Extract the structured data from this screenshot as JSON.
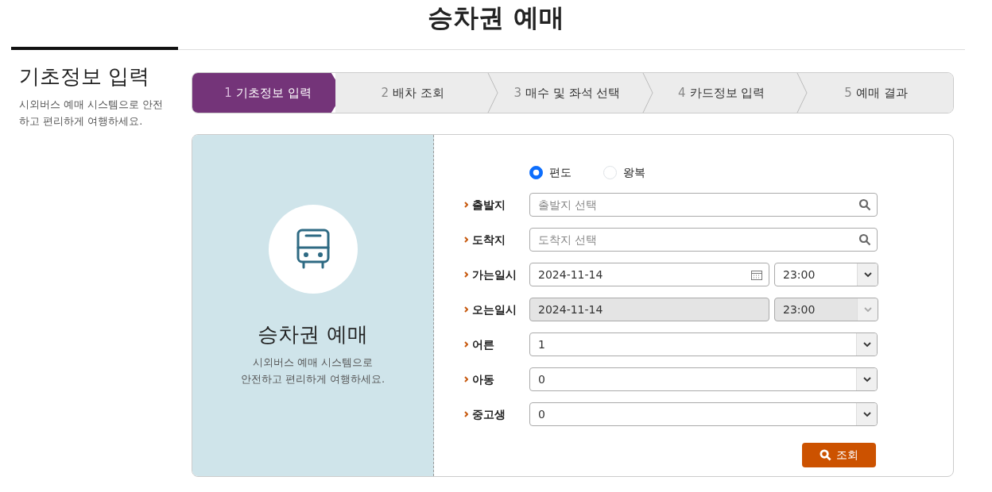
{
  "page_title": "승차권 예매",
  "sidebar": {
    "heading": "기초정보 입력",
    "description": "시외버스 예매 시스템으로 안전하고 편리하게 여행하세요."
  },
  "steps": [
    {
      "number": "1",
      "label": "기초정보 입력",
      "selected": true
    },
    {
      "number": "2",
      "label": "배차 조회",
      "selected": false
    },
    {
      "number": "3",
      "label": "매수 및 좌석 선택",
      "selected": false
    },
    {
      "number": "4",
      "label": "카드정보 입력",
      "selected": false
    },
    {
      "number": "5",
      "label": "예매 결과",
      "selected": false
    }
  ],
  "intro_panel": {
    "title": "승차권 예매",
    "lines": [
      "시외버스 예매 시스템으로",
      "안전하고 편리하게 여행하세요."
    ]
  },
  "trip_type": [
    {
      "label": "편도",
      "selected": true
    },
    {
      "label": "왕복",
      "selected": false
    }
  ],
  "fields": [
    {
      "kind": "search",
      "label": "출발지",
      "placeholder": "출발지 선택"
    },
    {
      "kind": "search",
      "label": "도착지",
      "placeholder": "도착지 선택"
    },
    {
      "kind": "datetime",
      "label": "가는일시",
      "date": "2024-11-14",
      "time": "23:00",
      "disabled": false
    },
    {
      "kind": "datetime",
      "label": "오는일시",
      "date": "2024-11-14",
      "time": "23:00",
      "disabled": true
    },
    {
      "kind": "select",
      "label": "어른",
      "value": "1"
    },
    {
      "kind": "select",
      "label": "아동",
      "value": "0"
    },
    {
      "kind": "select",
      "label": "중고생",
      "value": "0"
    }
  ],
  "submit_button": "조회"
}
